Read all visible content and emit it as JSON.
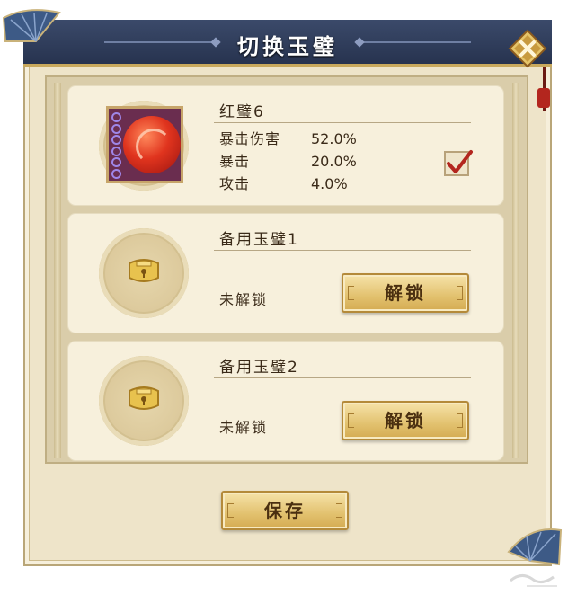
{
  "dialog": {
    "title": "切换玉璧"
  },
  "slots": [
    {
      "title": "红璧6",
      "stats": [
        {
          "name": "暴击伤害",
          "value": "52.0%"
        },
        {
          "name": "暴击",
          "value": "20.0%"
        },
        {
          "name": "攻击",
          "value": "4.0%"
        }
      ],
      "selected": true,
      "icon": "red-jade-icon"
    },
    {
      "title": "备用玉璧1",
      "status": "未解锁",
      "button_label": "解锁",
      "icon": "lock-icon"
    },
    {
      "title": "备用玉璧2",
      "status": "未解锁",
      "button_label": "解锁",
      "icon": "lock-icon"
    }
  ],
  "footer": {
    "save_label": "保存"
  },
  "colors": {
    "title_bar": "#27334f",
    "panel": "#eee4c9",
    "card": "#f7f0dc",
    "button": "#e2c16e",
    "check": "#b3261e"
  }
}
